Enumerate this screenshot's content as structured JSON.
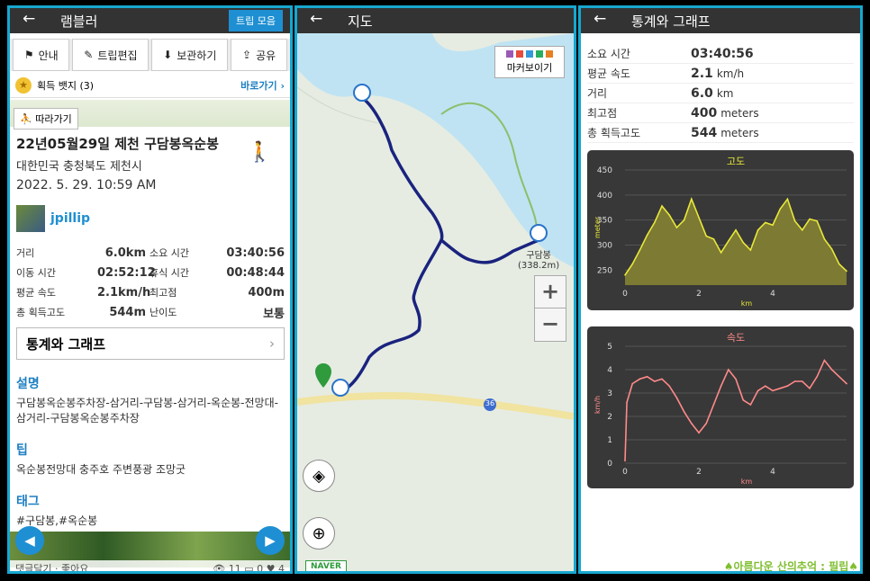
{
  "p1": {
    "title": "램블러",
    "back": "←",
    "trip_btn": "트립 모음",
    "actions": [
      {
        "icon": "⚑",
        "label": "안내"
      },
      {
        "icon": "✎",
        "label": "트립편집"
      },
      {
        "icon": "⬇",
        "label": "보관하기"
      },
      {
        "icon": "⇪",
        "label": "공유"
      }
    ],
    "badge": {
      "label": "획득 뱃지 (3)",
      "go": "바로가기 ›"
    },
    "follow": "따라가기",
    "trip_title": "22년05월29일 제천 구담봉옥순봉",
    "location": "대한민국 충청북도 제천시",
    "date": "2022. 5. 29. 10:59 AM",
    "user": "jpillip",
    "stats": [
      {
        "l1": "거리",
        "v1": "6.0km",
        "l2": "소요 시간",
        "v2": "03:40:56"
      },
      {
        "l1": "이동 시간",
        "v1": "02:52:12",
        "l2": "휴식 시간",
        "v2": "00:48:44"
      },
      {
        "l1": "평균 속도",
        "v1": "2.1km/h",
        "l2": "최고점",
        "v2": "400m"
      },
      {
        "l1": "총 획득고도",
        "v1": "544m",
        "l2": "난이도",
        "v2": "보통"
      }
    ],
    "graph_btn": "통계와 그래프",
    "desc_h": "설명",
    "desc": "구담봉옥순봉주차장-삼거리-구담봉-삼거리-옥순봉-전망대-삼거리-구담봉옥순봉주차장",
    "tip_h": "팁",
    "tip": "옥순봉전망대 충주호 주변풍광 조망굿",
    "tag_h": "태그",
    "tags": "#구담봉,#옥순봉",
    "footer": "댓글달기 · 좋아요",
    "counts": "👁 11   ▭ 0   ♥ 4"
  },
  "p2": {
    "title": "지도",
    "back": "←",
    "marker_btn": "마커보이기",
    "peak_name": "구담봉",
    "peak_alt": "(338.2m)",
    "road_no": "36",
    "zoom_in": "+",
    "zoom_out": "−",
    "naver": "NAVER"
  },
  "p3": {
    "title": "통계와 그래프",
    "back": "←",
    "stats": [
      {
        "label": "소요 시간",
        "value": "03:40:56",
        "unit": ""
      },
      {
        "label": "평균 속도",
        "value": "2.1",
        "unit": "km/h"
      },
      {
        "label": "거리",
        "value": "6.0",
        "unit": "km"
      },
      {
        "label": "최고점",
        "value": "400",
        "unit": "meters"
      },
      {
        "label": "총 획득고도",
        "value": "544",
        "unit": "meters"
      }
    ],
    "watermark": "♠아름다운 산의추억 : 필립♠"
  },
  "colors": {
    "accent": "#17a7cf",
    "link": "#1e8fd2",
    "route": "#1a237e",
    "chart_bg": "#383838",
    "alt_line": "#e8e83a",
    "speed_line": "#ff8a8a"
  },
  "chart_data": [
    {
      "type": "area",
      "title": "고도",
      "ylabel": "meter",
      "xlabel": "km",
      "xlim": [
        0,
        6
      ],
      "ylim": [
        220,
        450
      ],
      "yticks": [
        250,
        300,
        350,
        400,
        450
      ],
      "xticks": [
        0,
        2,
        4
      ],
      "x": [
        0,
        0.2,
        0.4,
        0.6,
        0.8,
        1.0,
        1.2,
        1.4,
        1.6,
        1.8,
        2.0,
        2.2,
        2.4,
        2.6,
        2.8,
        3.0,
        3.2,
        3.4,
        3.6,
        3.8,
        4.0,
        4.2,
        4.4,
        4.6,
        4.8,
        5.0,
        5.2,
        5.4,
        5.6,
        5.8,
        6.0
      ],
      "values": [
        240,
        262,
        290,
        320,
        345,
        378,
        360,
        335,
        350,
        392,
        355,
        318,
        312,
        285,
        308,
        330,
        305,
        290,
        330,
        345,
        340,
        372,
        392,
        348,
        330,
        352,
        348,
        312,
        292,
        262,
        248
      ]
    },
    {
      "type": "line",
      "title": "속도",
      "ylabel": "km/h",
      "xlabel": "km",
      "xlim": [
        0,
        6
      ],
      "ylim": [
        0,
        5
      ],
      "yticks": [
        0,
        1,
        2,
        3,
        4,
        5
      ],
      "xticks": [
        0,
        2,
        4
      ],
      "x": [
        0,
        0.05,
        0.2,
        0.4,
        0.6,
        0.8,
        1.0,
        1.2,
        1.4,
        1.6,
        1.8,
        2.0,
        2.2,
        2.4,
        2.6,
        2.8,
        3.0,
        3.2,
        3.4,
        3.6,
        3.8,
        4.0,
        4.2,
        4.4,
        4.6,
        4.8,
        5.0,
        5.2,
        5.4,
        5.6,
        5.8,
        6.0
      ],
      "values": [
        0.1,
        2.6,
        3.4,
        3.6,
        3.7,
        3.5,
        3.6,
        3.3,
        2.8,
        2.2,
        1.7,
        1.3,
        1.7,
        2.5,
        3.3,
        4.0,
        3.6,
        2.7,
        2.5,
        3.1,
        3.3,
        3.1,
        3.2,
        3.3,
        3.5,
        3.5,
        3.2,
        3.7,
        4.4,
        4.0,
        3.7,
        3.4
      ]
    }
  ]
}
